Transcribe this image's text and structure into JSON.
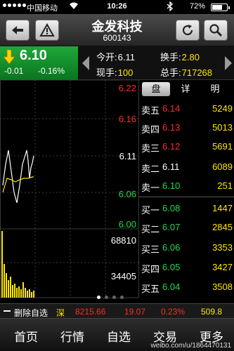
{
  "status": {
    "carrier": "中国移动",
    "time": "10:26",
    "battery": "72%",
    "battery_level": 0.72
  },
  "nav": {
    "title": "金发科技",
    "code": "600143",
    "back_icon": "back-arrow-icon",
    "alert_icon": "warning-icon",
    "refresh_icon": "refresh-icon",
    "search_icon": "search-icon"
  },
  "quote": {
    "price": "6.10",
    "change": "-0.01",
    "change_pct": "-0.16%",
    "open_label": "今开:",
    "open": "6.11",
    "turnover_label": "换手:",
    "turnover": "2.80",
    "current_vol_label": "现手:",
    "current_vol": "100",
    "total_vol_label": "总手:",
    "total_vol": "717268"
  },
  "chart": {
    "price_labels": [
      "6.22",
      "6.16",
      "6.11",
      "6.06",
      "6.00"
    ],
    "volume_labels": [
      "68810",
      "34405"
    ]
  },
  "book": {
    "tabs": [
      "盘",
      "详",
      "明"
    ],
    "asks": [
      {
        "label": "卖五",
        "price": "6.14",
        "volume": "5249"
      },
      {
        "label": "卖四",
        "price": "6.13",
        "volume": "5013"
      },
      {
        "label": "卖三",
        "price": "6.12",
        "volume": "5691"
      },
      {
        "label": "卖二",
        "price": "6.11",
        "volume": "6089"
      },
      {
        "label": "卖一",
        "price": "6.10",
        "volume": "251"
      }
    ],
    "bids": [
      {
        "label": "买一",
        "price": "6.08",
        "volume": "1447"
      },
      {
        "label": "买二",
        "price": "6.07",
        "volume": "2845"
      },
      {
        "label": "买三",
        "price": "6.06",
        "volume": "3353"
      },
      {
        "label": "买四",
        "price": "6.05",
        "volume": "3427"
      },
      {
        "label": "买五",
        "price": "6.04",
        "volume": "3508"
      }
    ]
  },
  "ticker": {
    "delete": "删除自选",
    "market": "深",
    "index": "8215.66",
    "change": "19.07",
    "change_pct": "0.23%",
    "amount": "509.8"
  },
  "tabbar": [
    "首页",
    "行情",
    "自选",
    "交易",
    "更多"
  ],
  "watermark": "weibo.com/u/1864470131"
}
